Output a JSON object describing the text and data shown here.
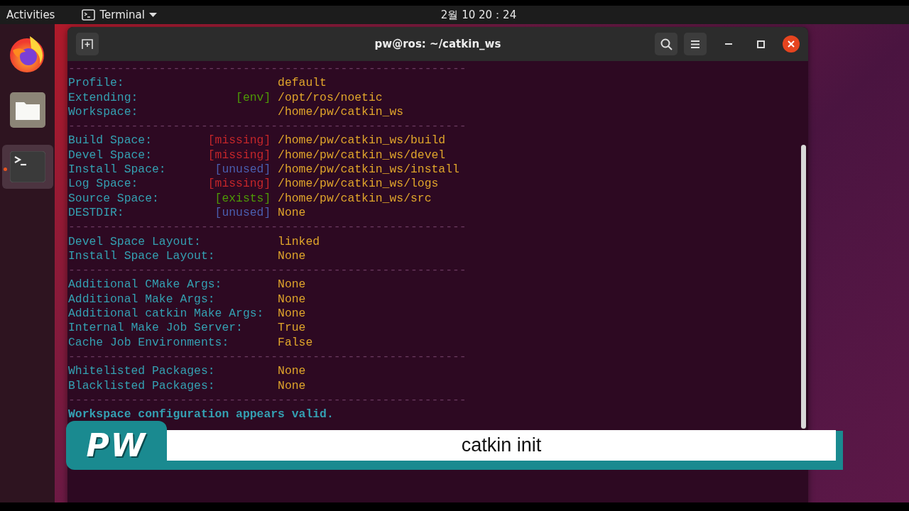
{
  "top_bar": {
    "activities": "Activities",
    "app_menu": "Terminal",
    "clock": "2월 10 20：24"
  },
  "dock": {
    "items": [
      {
        "kind": "browser",
        "running": false
      },
      {
        "kind": "files",
        "running": false
      },
      {
        "kind": "terminal",
        "running": true
      }
    ]
  },
  "terminal": {
    "title": "pw@ros: ~/catkin_ws",
    "lines": [
      {
        "kind": "rule",
        "text": "---------------------------------------------------------"
      },
      {
        "kind": "entry",
        "label": "Profile:",
        "value": "default"
      },
      {
        "kind": "entry",
        "label": "Extending:",
        "tag": {
          "text": "[env]",
          "color": "#4e9a06"
        },
        "value": "/opt/ros/noetic"
      },
      {
        "kind": "entry",
        "label": "Workspace:",
        "value": "/home/pw/catkin_ws"
      },
      {
        "kind": "rule",
        "text": "---------------------------------------------------------"
      },
      {
        "kind": "entry",
        "label": "Build Space:",
        "tag": {
          "text": "[missing]",
          "color": "#c4262a"
        },
        "value": "/home/pw/catkin_ws/build"
      },
      {
        "kind": "entry",
        "label": "Devel Space:",
        "tag": {
          "text": "[missing]",
          "color": "#c4262a"
        },
        "value": "/home/pw/catkin_ws/devel"
      },
      {
        "kind": "entry",
        "label": "Install Space:",
        "tag": {
          "text": "[unused]",
          "color": "#4a5fb0"
        },
        "value": "/home/pw/catkin_ws/install"
      },
      {
        "kind": "entry",
        "label": "Log Space:",
        "tag": {
          "text": "[missing]",
          "color": "#c4262a"
        },
        "value": "/home/pw/catkin_ws/logs"
      },
      {
        "kind": "entry",
        "label": "Source Space:",
        "tag": {
          "text": "[exists]",
          "color": "#4e9a06"
        },
        "value": "/home/pw/catkin_ws/src"
      },
      {
        "kind": "entry",
        "label": "DESTDIR:",
        "tag": {
          "text": "[unused]",
          "color": "#4a5fb0"
        },
        "value": "None"
      },
      {
        "kind": "rule",
        "text": "---------------------------------------------------------"
      },
      {
        "kind": "entry",
        "label": "Devel Space Layout:",
        "value": "linked"
      },
      {
        "kind": "entry",
        "label": "Install Space Layout:",
        "value": "None"
      },
      {
        "kind": "rule",
        "text": "---------------------------------------------------------"
      },
      {
        "kind": "entry",
        "label": "Additional CMake Args:",
        "value": "None"
      },
      {
        "kind": "entry",
        "label": "Additional Make Args:",
        "value": "None"
      },
      {
        "kind": "entry",
        "label": "Additional catkin Make Args:",
        "value": "None"
      },
      {
        "kind": "entry",
        "label": "Internal Make Job Server:",
        "value": "True"
      },
      {
        "kind": "entry",
        "label": "Cache Job Environments:",
        "value": "False"
      },
      {
        "kind": "rule",
        "text": "---------------------------------------------------------"
      },
      {
        "kind": "entry",
        "label": "Whitelisted Packages:",
        "value": "None"
      },
      {
        "kind": "entry",
        "label": "Blacklisted Packages:",
        "value": "None"
      },
      {
        "kind": "rule",
        "text": "---------------------------------------------------------"
      },
      {
        "kind": "message",
        "text": "Workspace configuration appears valid."
      }
    ]
  },
  "caption": {
    "badge": "PW",
    "text": "catkin init"
  }
}
